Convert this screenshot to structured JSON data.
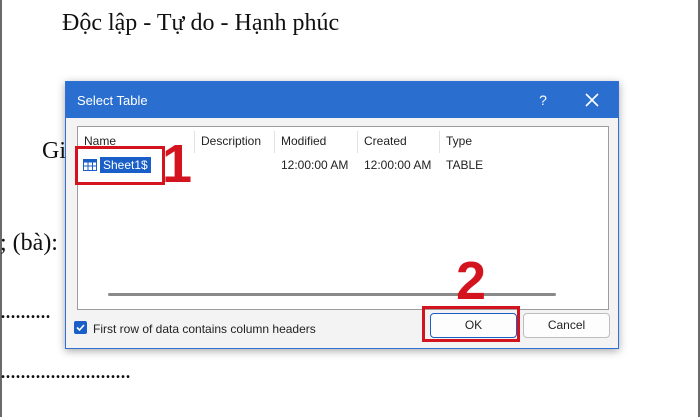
{
  "document": {
    "heading": "Độc lập - Tự do - Hạnh phúc",
    "fragment_gi": "Gi",
    "fragment_ba": "; (bà):",
    "dots_line1": "..........",
    "dots_line2": ".........................."
  },
  "dialog": {
    "title": "Select Table",
    "help_label": "?",
    "columns": [
      "Name",
      "Description",
      "Modified",
      "Created",
      "Type"
    ],
    "rows": [
      {
        "name": "Sheet1$",
        "description": "",
        "modified": "12:00:00 AM",
        "created": "12:00:00 AM",
        "type": "TABLE"
      }
    ],
    "checkbox_label": "First row of data contains column headers",
    "checkbox_checked": true,
    "ok_label": "OK",
    "cancel_label": "Cancel"
  },
  "annotations": {
    "step1": "1",
    "step2": "2",
    "color": "#d3141f"
  },
  "colors": {
    "titlebar": "#2a6fd0",
    "selection": "#1a5fc8"
  }
}
